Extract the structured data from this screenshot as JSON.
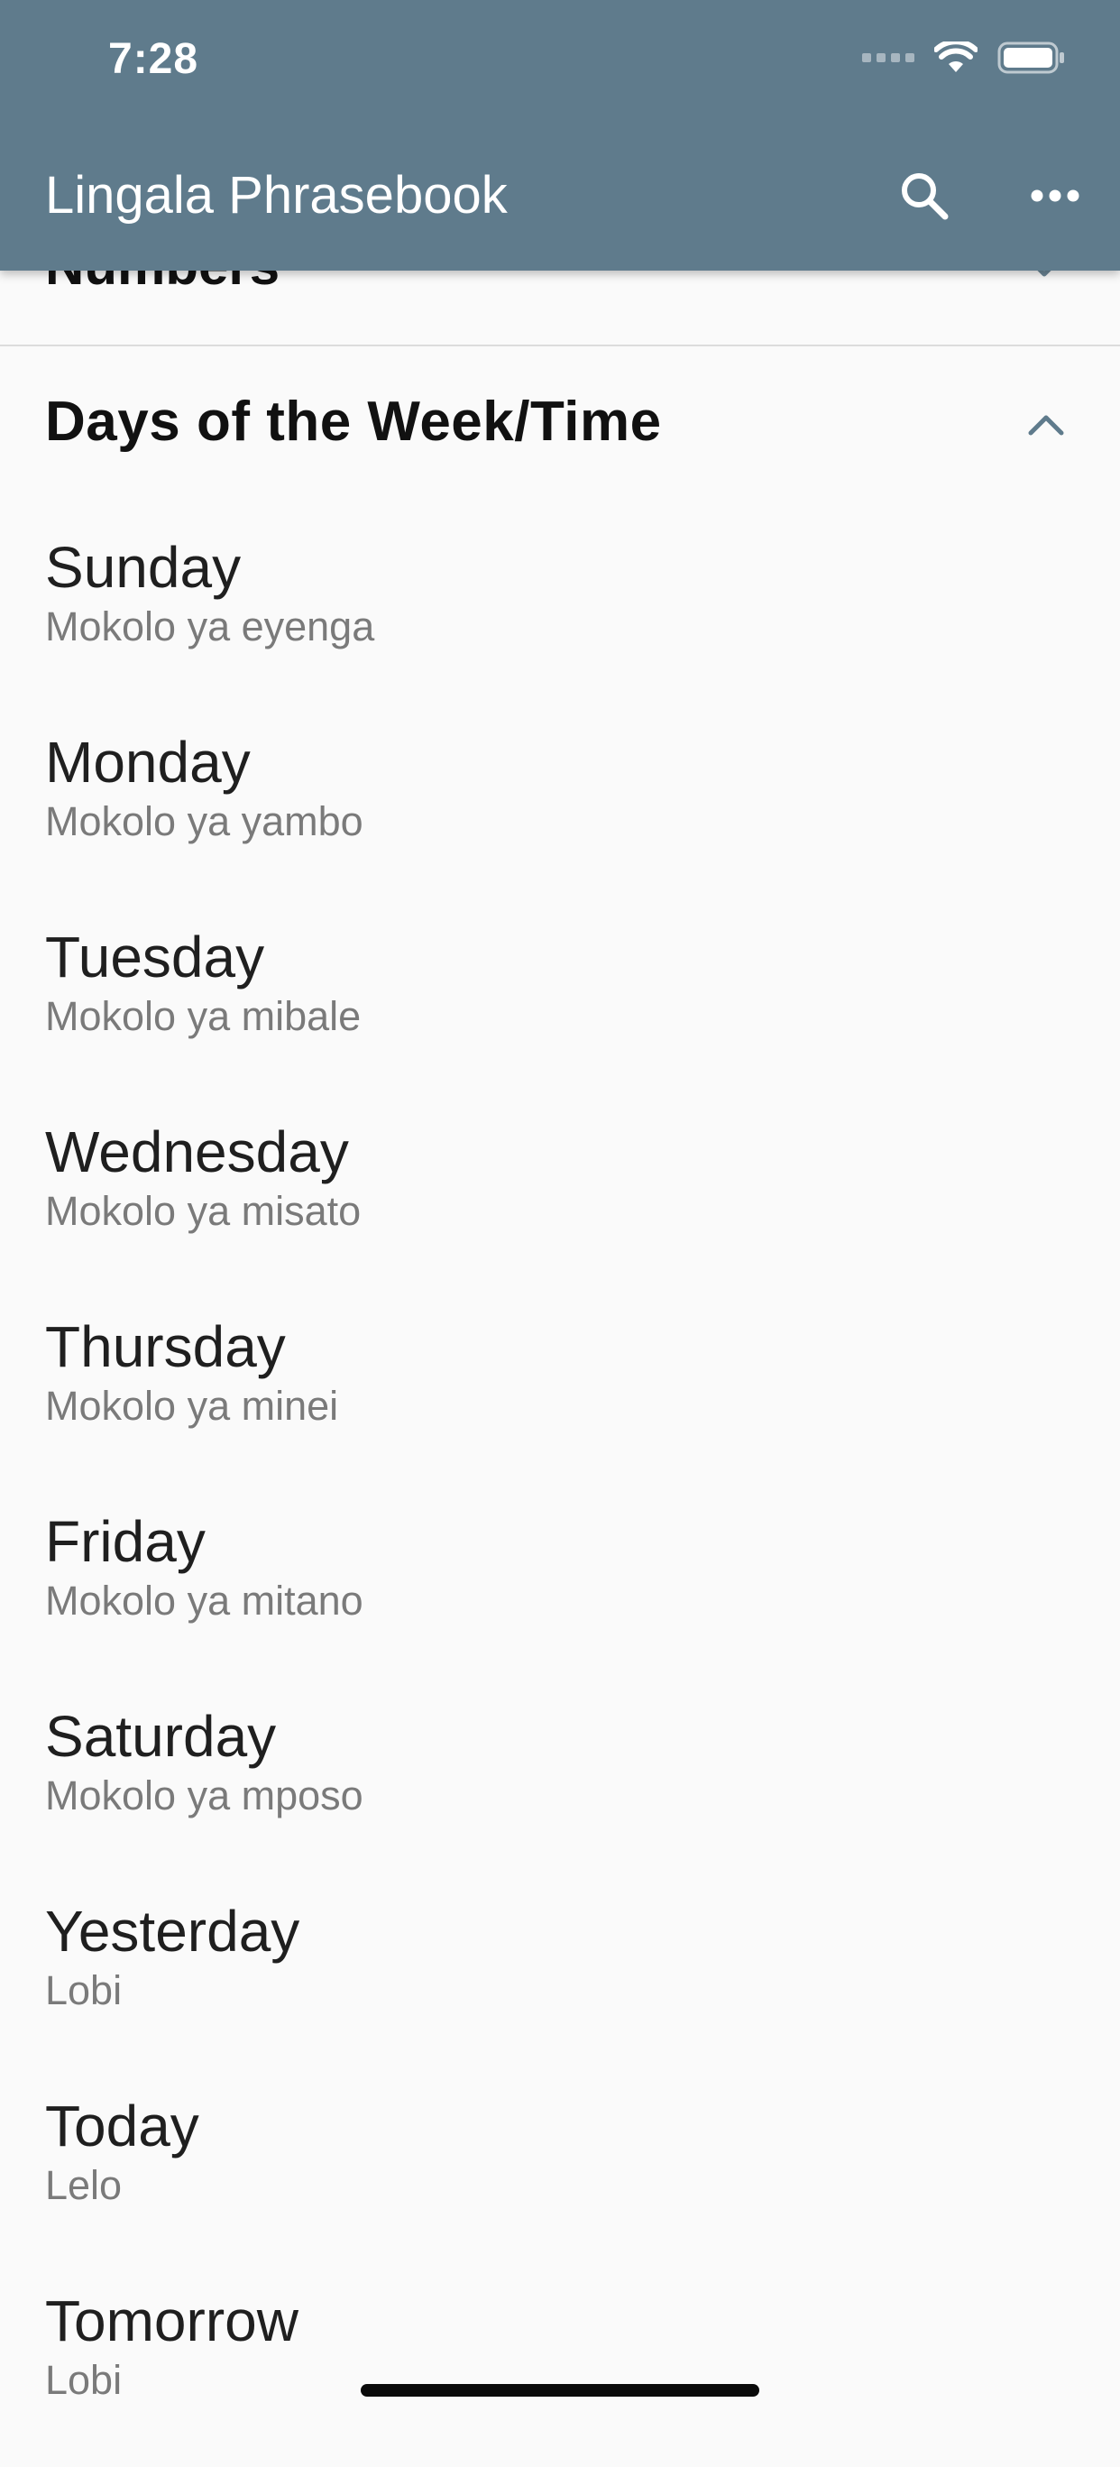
{
  "status_bar": {
    "time": "7:28"
  },
  "app_bar": {
    "title": "Lingala Phrasebook",
    "background": "#5f7b8c",
    "actions": {
      "search_icon": "search-icon",
      "more_icon": "more-horizontal-icon"
    }
  },
  "previous_section": {
    "title": "Numbers"
  },
  "section": {
    "title": "Days of the Week/Time",
    "expanded": true,
    "items": [
      {
        "english": "Sunday",
        "lingala": "Mokolo ya eyenga"
      },
      {
        "english": "Monday",
        "lingala": "Mokolo ya yambo"
      },
      {
        "english": "Tuesday",
        "lingala": "Mokolo ya mibale"
      },
      {
        "english": "Wednesday",
        "lingala": "Mokolo ya misato"
      },
      {
        "english": "Thursday",
        "lingala": "Mokolo ya minei"
      },
      {
        "english": "Friday",
        "lingala": "Mokolo ya mitano"
      },
      {
        "english": "Saturday",
        "lingala": "Mokolo ya mposo"
      },
      {
        "english": "Yesterday",
        "lingala": "Lobi"
      },
      {
        "english": "Today",
        "lingala": "Lelo"
      },
      {
        "english": "Tomorrow",
        "lingala": "Lobi"
      }
    ]
  }
}
